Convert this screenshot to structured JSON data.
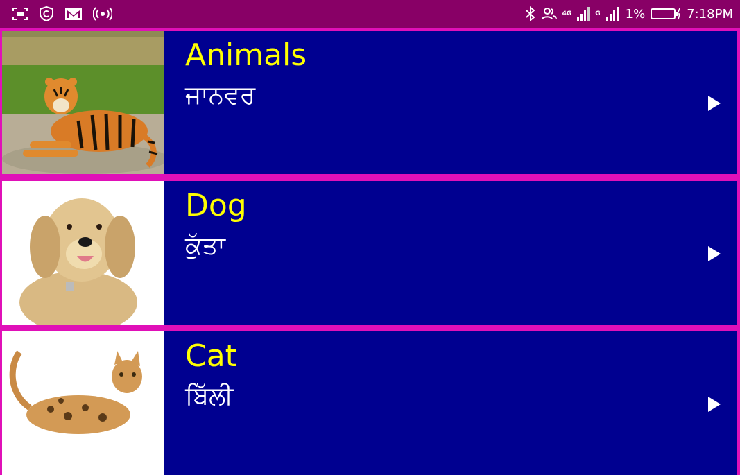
{
  "status_bar": {
    "battery_percent": "1%",
    "time": "7:18PM",
    "network_4g": "4G",
    "network_g": "G",
    "background_color": "#880066",
    "left_icons": [
      "screenshot-icon",
      "c-shield-icon",
      "gmail-icon",
      "hotspot-icon"
    ],
    "right_icons": [
      "bluetooth-icon",
      "contacts-icon",
      "signal-icon",
      "battery-icon"
    ]
  },
  "list": {
    "background_color": "#000090",
    "border_color": "#e010b8",
    "title_color": "#ffff00",
    "items": [
      {
        "title": "Animals",
        "subtitle": "ਜਾਨਵਰ",
        "image": "tiger"
      },
      {
        "title": "Dog",
        "subtitle": "ਕੁੱਤਾ",
        "image": "dog"
      },
      {
        "title": "Cat",
        "subtitle": "ਬਿੱਲੀ",
        "image": "cat"
      }
    ]
  }
}
